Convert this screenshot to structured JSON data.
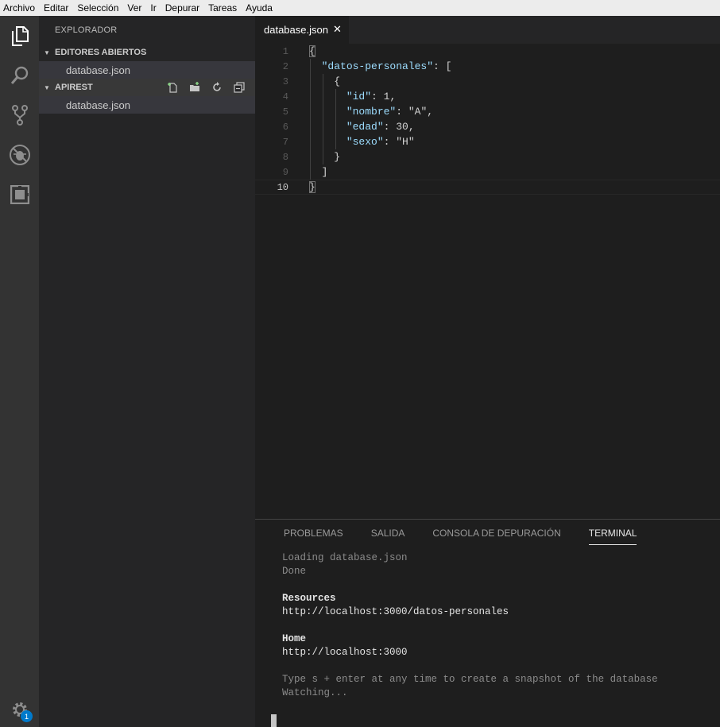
{
  "menu": [
    "Archivo",
    "Editar",
    "Selección",
    "Ver",
    "Ir",
    "Depurar",
    "Tareas",
    "Ayuda"
  ],
  "activity": {
    "icons": [
      "files-icon",
      "search-icon",
      "source-control-icon",
      "debug-icon",
      "extensions-icon",
      "gear-icon"
    ],
    "settings_badge": "1"
  },
  "sidebar": {
    "title": "EXPLORADOR",
    "open_editors": {
      "label": "EDITORES ABIERTOS",
      "files": [
        "database.json"
      ]
    },
    "project": {
      "label": "APIREST",
      "files": [
        "database.json"
      ]
    }
  },
  "editor": {
    "tab_label": "database.json",
    "close_glyph": "✕",
    "line_numbers": [
      "1",
      "2",
      "3",
      "4",
      "5",
      "6",
      "7",
      "8",
      "9",
      "10"
    ],
    "lines": [
      "{",
      "  \"datos-personales\": [",
      "    {",
      "      \"id\": 1,",
      "      \"nombre\": \"A\",",
      "      \"edad\": 30,",
      "      \"sexo\": \"H\"",
      "    }",
      "  ]",
      "}"
    ]
  },
  "panel": {
    "tabs": [
      "PROBLEMAS",
      "SALIDA",
      "CONSOLA DE DEPURACIÓN",
      "TERMINAL"
    ],
    "active_tab": "TERMINAL",
    "terminal": {
      "loading": "Loading database.json",
      "done": "Done",
      "resources_title": "Resources",
      "resources_url": "http://localhost:3000/datos-personales",
      "home_title": "Home",
      "home_url": "http://localhost:3000",
      "hint": "Type s + enter at any time to create a snapshot of the database",
      "watching": "Watching..."
    }
  },
  "colors": {
    "activity_bar": "#333333",
    "sidebar": "#252526",
    "editor": "#1e1e1e",
    "json_key": "#9cdcfe",
    "json_string": "#ce9178",
    "json_number": "#b5cea8",
    "badge": "#007acc"
  }
}
